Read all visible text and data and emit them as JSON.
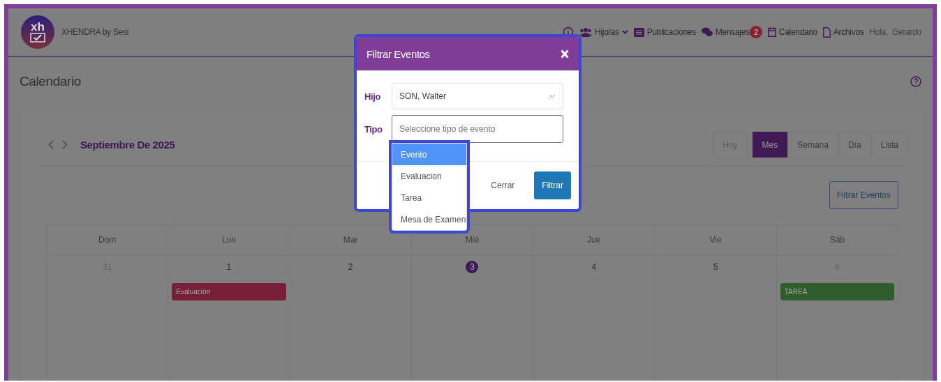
{
  "header": {
    "brand": "XHENDRA by Sesi",
    "logo_text": "xh",
    "nav": [
      {
        "kind": "info"
      },
      {
        "kind": "users",
        "label": "Hijo/as",
        "dropdown": true
      },
      {
        "kind": "list",
        "label": "Publicaciones"
      },
      {
        "kind": "chat",
        "label": "Mensajes",
        "badge": "2"
      },
      {
        "kind": "calendar",
        "label": "Calendario"
      },
      {
        "kind": "file",
        "label": "Archivos"
      }
    ],
    "greeting": "Hola,  Gerardo"
  },
  "page_title": "Calendario",
  "calendar": {
    "title": "Septiembre De 2025",
    "today_button": {
      "label": "Hoy",
      "disabled": true
    },
    "views": [
      {
        "label": "Mes",
        "selected": true
      },
      {
        "label": "Semana",
        "selected": false
      },
      {
        "label": "Día",
        "selected": false
      },
      {
        "label": "Lista",
        "selected": false
      }
    ],
    "filter_button": "Filtrar Eventos",
    "weekdays": [
      "Dom",
      "Lun",
      "Mar",
      "Mié",
      "Jue",
      "Vie",
      "Sáb"
    ],
    "days": [
      {
        "label": "31",
        "muted": true,
        "today": false
      },
      {
        "label": "1",
        "muted": false,
        "today": false,
        "events": [
          {
            "title": "Evaluación",
            "color": "#761f37"
          }
        ]
      },
      {
        "label": "2",
        "muted": false,
        "today": false
      },
      {
        "label": "3",
        "muted": false,
        "today": true
      },
      {
        "label": "4",
        "muted": false,
        "today": false
      },
      {
        "label": "5",
        "muted": false,
        "today": false
      },
      {
        "label": "6",
        "muted": true,
        "today": false,
        "events": [
          {
            "title": "TAREA",
            "color": "#2f5d2c"
          }
        ]
      }
    ]
  },
  "modal": {
    "title": "Filtrar Eventos",
    "child_field": {
      "label": "Hijo",
      "value": "SON, Walter"
    },
    "type_field": {
      "label": "Tipo",
      "placeholder": "Seleccione tipo de evento"
    },
    "type_options": [
      {
        "label": "Evento",
        "selected": true
      },
      {
        "label": "Evaluacion",
        "selected": false
      },
      {
        "label": "Tarea",
        "selected": false
      },
      {
        "label": "Mesa de Examen",
        "selected": false
      }
    ],
    "buttons": [
      {
        "label": "Cerrar",
        "kind": "secondary"
      },
      {
        "label": "Filtrar",
        "kind": "primary"
      }
    ]
  }
}
